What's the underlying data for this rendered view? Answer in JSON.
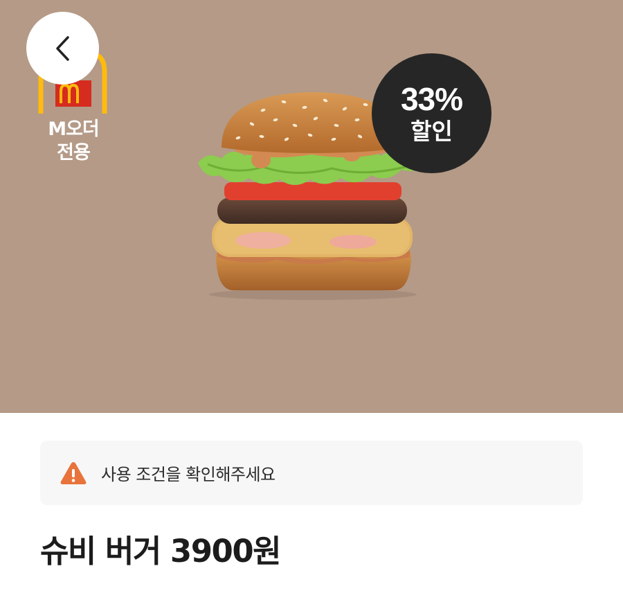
{
  "hero": {
    "background_color": "#b49a87",
    "brand_label": "M오더\n전용",
    "discount": {
      "percent": "33%",
      "label": "할인"
    },
    "product_image": "burger-image"
  },
  "nav": {
    "back_icon": "chevron-left-icon"
  },
  "notice": {
    "icon": "warning-icon",
    "text": "사용 조건을 확인해주세요"
  },
  "product": {
    "title": "슈비 버거 3900원"
  },
  "colors": {
    "logo_red": "#d62b1f",
    "logo_yellow": "#ffbc0d",
    "badge_bg": "#262626",
    "warning_orange": "#e8743b"
  }
}
